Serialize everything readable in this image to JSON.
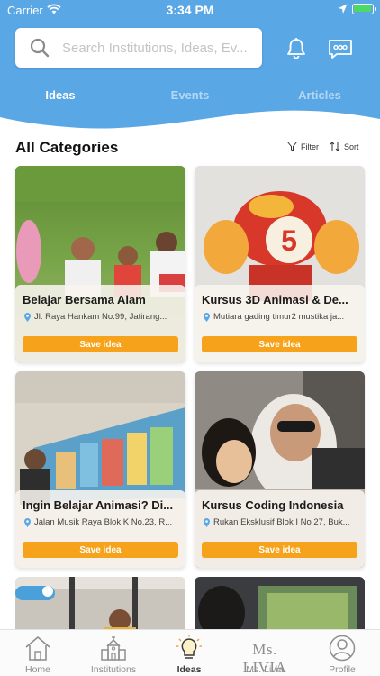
{
  "status_bar": {
    "carrier": "Carrier",
    "time": "3:34 PM"
  },
  "search": {
    "placeholder": "Search Institutions, Ideas, Ev..."
  },
  "tabs": [
    {
      "label": "Ideas",
      "active": true
    },
    {
      "label": "Events",
      "active": false
    },
    {
      "label": "Articles",
      "active": false
    }
  ],
  "section": {
    "title": "All Categories",
    "filter_label": "Filter",
    "sort_label": "Sort"
  },
  "cards": [
    {
      "title": "Belajar Bersama Alam",
      "address": "Jl. Raya Hankam No.99, Jatirang...",
      "button": "Save idea"
    },
    {
      "title": "Kursus 3D Animasi & De...",
      "address": "Mutiara gading timur2 mustika ja...",
      "button": "Save idea"
    },
    {
      "title": "Ingin Belajar Animasi? Di...",
      "address": "Jalan Musik Raya Blok K No.23, R...",
      "button": "Save idea"
    },
    {
      "title": "Kursus Coding Indonesia",
      "address": "Rukan Eksklusif Blok I No 27, Buk...",
      "button": "Save idea"
    }
  ],
  "bottom_nav": [
    {
      "label": "Home",
      "icon": "home-icon",
      "active": false
    },
    {
      "label": "Institutions",
      "icon": "institution-icon",
      "active": false
    },
    {
      "label": "Ideas",
      "icon": "lightbulb-icon",
      "active": true
    },
    {
      "label": "Ms. Livia",
      "icon": "ms-livia-logo",
      "active": false,
      "logo_text": "Ms. LIVIA"
    },
    {
      "label": "Profile",
      "icon": "profile-icon",
      "active": false
    }
  ],
  "colors": {
    "header": "#5aa7e6",
    "accent": "#f6a21a",
    "battery": "#4cd964"
  }
}
